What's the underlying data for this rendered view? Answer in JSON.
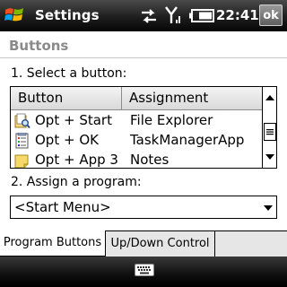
{
  "titlebar": {
    "title": "Settings",
    "time": "22:41",
    "ok_label": "ok",
    "icons": [
      "windows-start-icon",
      "sync-arrows-icon",
      "signal-strength-icon",
      "battery-icon"
    ]
  },
  "page": {
    "heading": "Buttons",
    "select_label": "1. Select a button:",
    "assign_label": "2. Assign a program:"
  },
  "list": {
    "columns": [
      "Button",
      "Assignment"
    ],
    "rows": [
      {
        "button": "Opt + Start",
        "assignment": "File Explorer",
        "icon": "file-explorer-icon"
      },
      {
        "button": "Opt + OK",
        "assignment": "TaskManagerApp",
        "icon": "task-manager-icon"
      },
      {
        "button": "Opt + App 3",
        "assignment": "Notes",
        "icon": "notes-icon"
      }
    ]
  },
  "program_select": {
    "value": "<Start Menu>"
  },
  "tabs": [
    {
      "label": "Program Buttons",
      "active": true
    },
    {
      "label": "Up/Down Control",
      "active": false
    }
  ],
  "softkeys": {
    "center_icon": "keyboard-icon"
  }
}
